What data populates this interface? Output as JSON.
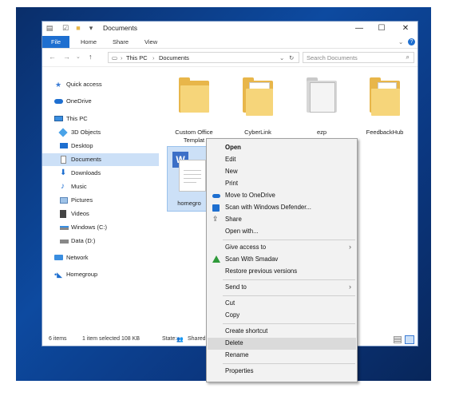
{
  "window": {
    "title": "Documents",
    "minimize": "—",
    "maximize": "☐",
    "close": "✕"
  },
  "ribbon": {
    "tabs": [
      "File",
      "Home",
      "Share",
      "View"
    ]
  },
  "address": {
    "path": [
      "This PC",
      "Documents"
    ],
    "search_placeholder": "Search Documents"
  },
  "nav": {
    "items": [
      {
        "label": "Quick access",
        "icon": "star-icon"
      },
      {
        "label": "OneDrive",
        "icon": "cloud-icon"
      },
      {
        "label": "This PC",
        "icon": "computer-icon"
      },
      {
        "label": "3D Objects",
        "icon": "cube-icon"
      },
      {
        "label": "Desktop",
        "icon": "desktop-icon"
      },
      {
        "label": "Documents",
        "icon": "document-icon",
        "selected": true
      },
      {
        "label": "Downloads",
        "icon": "download-icon"
      },
      {
        "label": "Music",
        "icon": "music-icon"
      },
      {
        "label": "Pictures",
        "icon": "pictures-icon"
      },
      {
        "label": "Videos",
        "icon": "video-icon"
      },
      {
        "label": "Windows (C:)",
        "icon": "drive-icon"
      },
      {
        "label": "Data (D:)",
        "icon": "drive-icon"
      },
      {
        "label": "Network",
        "icon": "network-icon"
      },
      {
        "label": "Homegroup",
        "icon": "homegroup-icon"
      }
    ]
  },
  "files": [
    {
      "label": "Custom Office Templat",
      "type": "folder"
    },
    {
      "label": "CyberLink",
      "type": "folder"
    },
    {
      "label": "ezp",
      "type": "folder-docs"
    },
    {
      "label": "FeedbackHub",
      "type": "folder"
    },
    {
      "label": "homegro",
      "type": "document"
    }
  ],
  "status": {
    "items": "6 items",
    "selected": "1 item selected  108 KB",
    "state": "State:",
    "shared": "Shared"
  },
  "context_menu": {
    "items": [
      {
        "label": "Open",
        "bold": true
      },
      {
        "label": "Edit"
      },
      {
        "label": "New"
      },
      {
        "label": "Print"
      },
      {
        "label": "Move to OneDrive",
        "icon": "onedrive-icon"
      },
      {
        "label": "Scan with Windows Defender...",
        "icon": "defender-icon"
      },
      {
        "label": "Share",
        "icon": "share-icon"
      },
      {
        "label": "Open with..."
      },
      {
        "label": "Give access to",
        "submenu": true
      },
      {
        "label": "Scan With Smadav",
        "icon": "smadav-icon"
      },
      {
        "label": "Restore previous versions"
      },
      {
        "label": "Send to",
        "submenu": true
      },
      {
        "label": "Cut"
      },
      {
        "label": "Copy"
      },
      {
        "label": "Create shortcut"
      },
      {
        "label": "Delete",
        "highlighted": true
      },
      {
        "label": "Rename"
      },
      {
        "label": "Properties"
      }
    ],
    "submenu_arrow": "›"
  },
  "colors": {
    "accent": "#1e6fd0",
    "selection": "#cce0f7",
    "folder": "#f6d57a",
    "desktop": "#0d4aa0"
  }
}
